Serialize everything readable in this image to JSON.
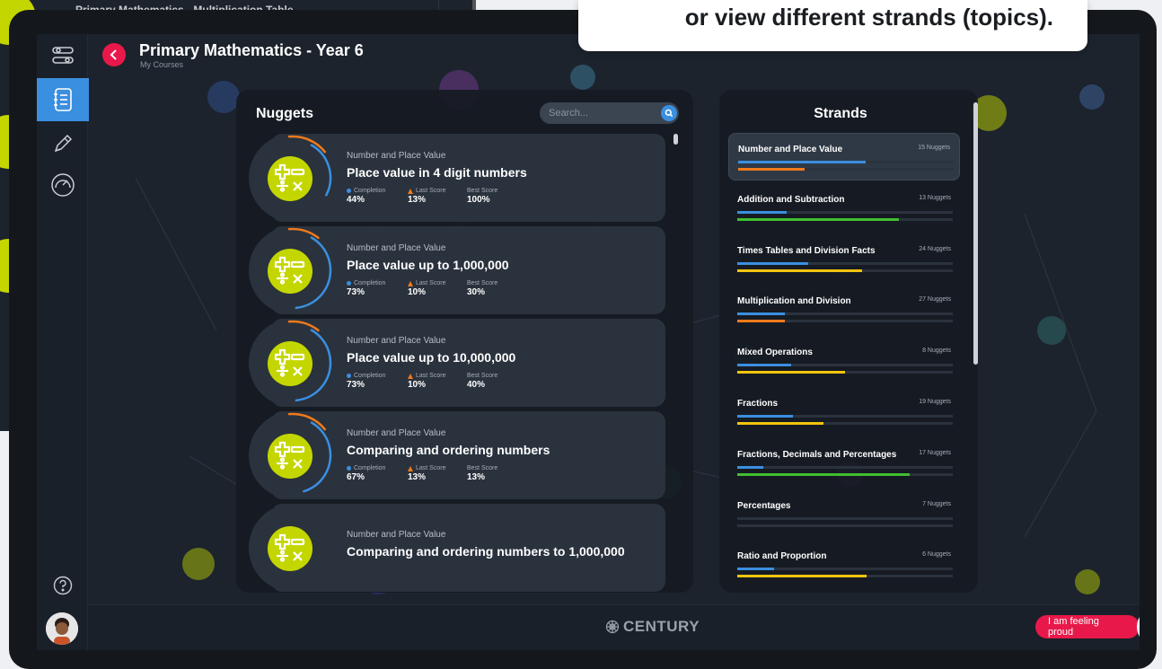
{
  "background_page": {
    "title": "Primary Mathematics - Multiplication Table"
  },
  "tooltip": {
    "text": "or view different strands (topics)."
  },
  "header": {
    "title": "Primary Mathematics - Year 6",
    "subtitle": "My Courses"
  },
  "sidebar": {
    "items": [
      {
        "icon": "settings-sliders-icon"
      },
      {
        "icon": "notebook-icon",
        "active": true
      },
      {
        "icon": "pencil-icon"
      },
      {
        "icon": "gauge-icon"
      }
    ],
    "help_icon": "help-icon"
  },
  "nuggets": {
    "title": "Nuggets",
    "search_placeholder": "Search...",
    "stat_labels": {
      "completion": "Completion",
      "last_score": "Last Score",
      "best_score": "Best Score"
    },
    "items": [
      {
        "strand": "Number and Place Value",
        "name": "Place value in 4 digit numbers",
        "completion": "44%",
        "last_score": "13%",
        "best_score": "100%",
        "completion_frac": 0.44,
        "best_frac": 0.13
      },
      {
        "strand": "Number and Place Value",
        "name": "Place value up to 1,000,000",
        "completion": "73%",
        "last_score": "10%",
        "best_score": "30%",
        "completion_frac": 0.73,
        "best_frac": 0.1
      },
      {
        "strand": "Number and Place Value",
        "name": "Place value up to 10,000,000",
        "completion": "73%",
        "last_score": "10%",
        "best_score": "40%",
        "completion_frac": 0.73,
        "best_frac": 0.1
      },
      {
        "strand": "Number and Place Value",
        "name": "Comparing and ordering numbers",
        "completion": "67%",
        "last_score": "13%",
        "best_score": "13%",
        "completion_frac": 0.67,
        "best_frac": 0.13
      },
      {
        "strand": "Number and Place Value",
        "name": "Comparing and ordering numbers to 1,000,000",
        "completion": "",
        "last_score": "",
        "best_score": "",
        "completion_frac": 0,
        "best_frac": 0
      }
    ]
  },
  "strands": {
    "title": "Strands",
    "items": [
      {
        "name": "Number and Place Value",
        "count": "15 Nuggets",
        "selected": true,
        "completion": 0.59,
        "score": 0.31,
        "score_color": "#f07a1a"
      },
      {
        "name": "Addition and Subtraction",
        "count": "13 Nuggets",
        "completion": 0.23,
        "score": 0.75,
        "score_color": "#3fbf2f"
      },
      {
        "name": "Times Tables and Division Facts",
        "count": "24 Nuggets",
        "completion": 0.33,
        "score": 0.58,
        "score_color": "#f2c40e"
      },
      {
        "name": "Multiplication and Division",
        "count": "27 Nuggets",
        "completion": 0.22,
        "score": 0.22,
        "score_color": "#f07a1a"
      },
      {
        "name": "Mixed Operations",
        "count": "8 Nuggets",
        "completion": 0.25,
        "score": 0.5,
        "score_color": "#f2c40e"
      },
      {
        "name": "Fractions",
        "count": "19 Nuggets",
        "completion": 0.26,
        "score": 0.4,
        "score_color": "#f2c40e"
      },
      {
        "name": "Fractions, Decimals and Percentages",
        "count": "17 Nuggets",
        "completion": 0.12,
        "score": 0.8,
        "score_color": "#3fbf2f"
      },
      {
        "name": "Percentages",
        "count": "7 Nuggets",
        "completion": 0,
        "score": 0,
        "score_color": "#f2c40e"
      },
      {
        "name": "Ratio and Proportion",
        "count": "6 Nuggets",
        "completion": 0.17,
        "score": 0.6,
        "score_color": "#f2c40e"
      }
    ]
  },
  "footer": {
    "brand": "CENTURY",
    "feeling_button": "I am feeling proud",
    "emoji_icon": "relieved-face-icon"
  },
  "colors": {
    "accent_blue": "#3b8fe0",
    "brand_red": "#e8194a",
    "nugget_green": "#c4d600",
    "orange": "#f07a1a"
  }
}
